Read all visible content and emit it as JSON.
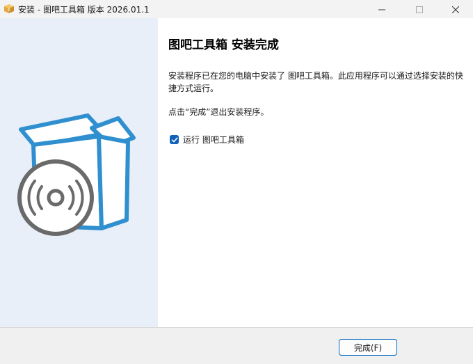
{
  "window": {
    "title": "安装 - 图吧工具箱 版本 2026.01.1",
    "app_icon": "package-box-icon",
    "controls": [
      "minimize-icon",
      "maximize-icon",
      "close-icon"
    ]
  },
  "banner": {
    "illustration": "software-box-with-disc-icon",
    "accent_color": "#2f8fcf",
    "disc_color": "#6a6a6a"
  },
  "content": {
    "heading": "图吧工具箱 安装完成",
    "message_line1": "安装程序已在您的电脑中安装了 图吧工具箱。此应用程序可以通过选择安装的快捷方式运行。",
    "message_line2": "点击“完成”退出安装程序。",
    "run_checkbox": {
      "label": "运行 图吧工具箱",
      "checked": true
    }
  },
  "footer": {
    "finish_label": "完成(F)"
  }
}
